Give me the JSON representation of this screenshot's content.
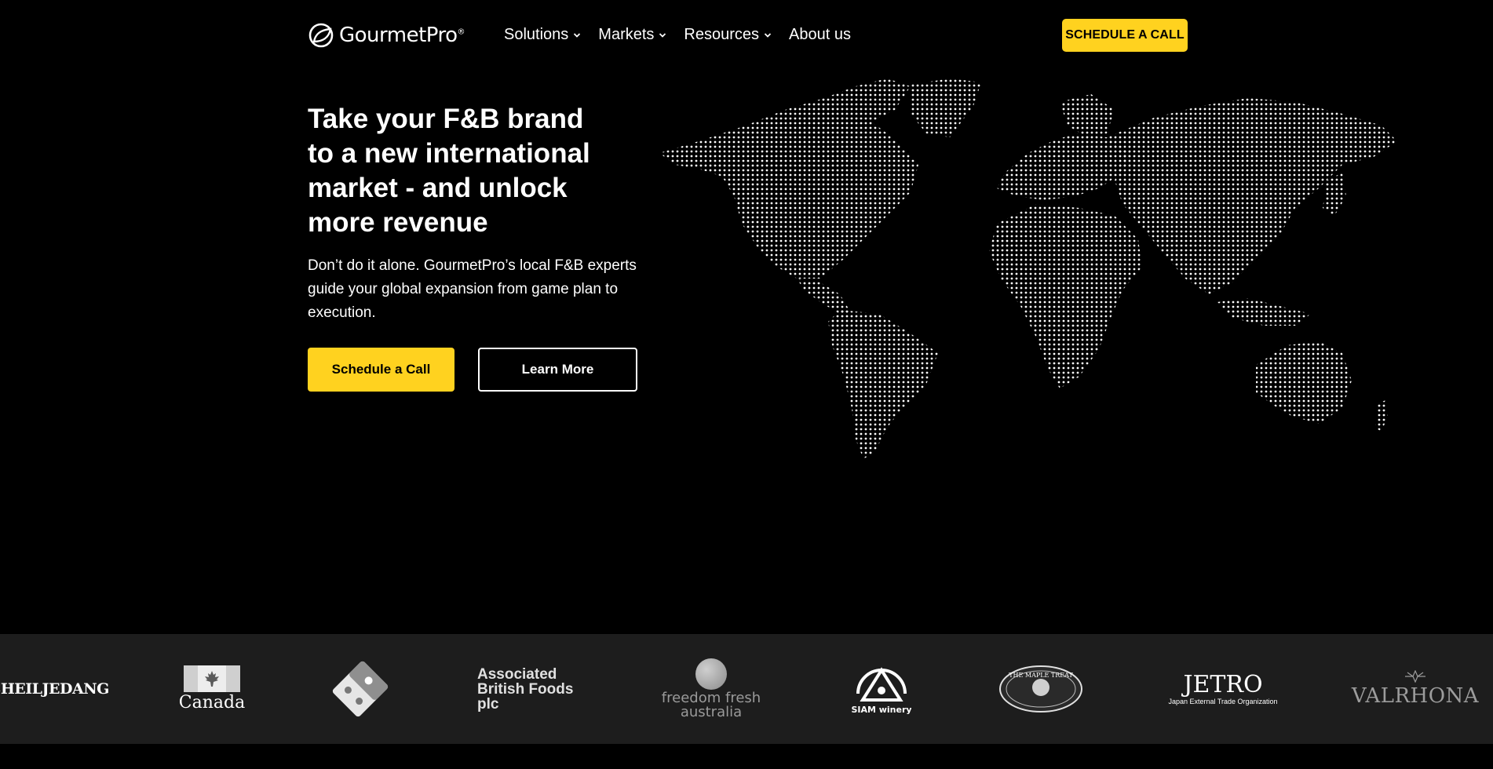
{
  "header": {
    "logo_text": "GourmetPro",
    "logo_mark": "®",
    "nav": [
      {
        "label": "Solutions",
        "has_dropdown": true
      },
      {
        "label": "Markets",
        "has_dropdown": true
      },
      {
        "label": "Resources",
        "has_dropdown": true
      },
      {
        "label": "About us",
        "has_dropdown": false
      }
    ],
    "cta_label": "SCHEDULE A CALL"
  },
  "hero": {
    "title": "Take your F&B brand\nto a new international\nmarket - and unlock\nmore revenue",
    "subtitle": "Don’t do it alone. GourmetPro’s local F&B experts guide your global expansion from game plan to execution.",
    "primary_button": "Schedule a Call",
    "secondary_button": "Learn More"
  },
  "clients": [
    {
      "name": "CHEILJEDANG"
    },
    {
      "name": "Canada"
    },
    {
      "name": "Domino's Pizza"
    },
    {
      "name": "Associated\nBritish Foods\nplc"
    },
    {
      "name": "freedom fresh\naustralia"
    },
    {
      "name": "SIAM winery"
    },
    {
      "name": "THE MAPLE TREAT"
    },
    {
      "name": "JETRO",
      "tagline": "Japan External Trade Organization"
    },
    {
      "name": "VALRHONA"
    }
  ],
  "colors": {
    "background": "#000000",
    "accent": "#ffd21f",
    "strip": "#1d1d1d"
  }
}
